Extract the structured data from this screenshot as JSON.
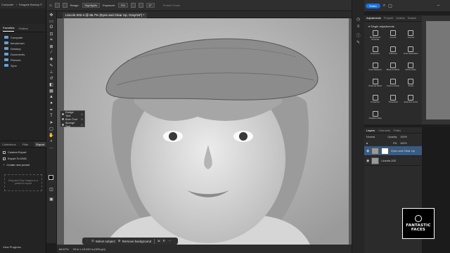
{
  "left_panel": {
    "breadcrumb": [
      "Computer",
      "Seagate Backup P"
    ],
    "tabs": [
      "Favorites",
      "Folders"
    ],
    "folders": [
      "Computer",
      "kerrybrown",
      "Desktop",
      "Documents",
      "Pictures",
      "Sync"
    ],
    "bottom_tabs": [
      "Collections",
      "Filter",
      "Export"
    ],
    "export_items": [
      "Custom Export",
      "Export To DNG",
      "Create new preset"
    ],
    "dropzone": "Drag and Drop images to a preset to export",
    "view_progress": "View Progress"
  },
  "options_bar": {
    "range_label": "Range:",
    "range_value": "Highlights",
    "exposure_label": "Exposure:",
    "exposure_value": "9%",
    "angle_value": "0°",
    "protect_tones": "Protect Tones"
  },
  "document": {
    "title": "Lincoln-202-4 @ 66.7% (Eyes and Clear Up, Gray/16*) *",
    "zoom": "66.67%",
    "doc_info": "29 in x 15.333 in (300 ppi)"
  },
  "tool_flyout": {
    "items": [
      {
        "label": "Dodge Tool",
        "key": "O"
      },
      {
        "label": "Burn Tool",
        "key": "O"
      },
      {
        "label": "Sponge Tool",
        "key": "O"
      }
    ]
  },
  "context_bar": {
    "select_subject": "Select subject",
    "remove_background": "Remove background"
  },
  "topbar_right": {
    "share": "Share"
  },
  "adjustments": {
    "tabs": [
      "Adjustments",
      "Properti",
      "Actions",
      "Swatch"
    ],
    "heading": "Single adjustments",
    "items": [
      "Brightness/ Contrast",
      "Levels",
      "Curves",
      "Exposure",
      "Vibrance",
      "Hue/ Saturation",
      "Color Balance",
      "Black & White",
      "Photo Filter",
      "Channel Mixer",
      "Color Lookup",
      "Invert",
      "Posterize",
      "Threshold",
      "Selective Color",
      "Gradient Map"
    ]
  },
  "layers": {
    "tabs": [
      "Layers",
      "Channels",
      "Paths"
    ],
    "blend_mode": "Normal",
    "opacity_label": "Opacity:",
    "opacity_value": "100%",
    "fill_label": "Fill:",
    "fill_value": "100%",
    "rows": [
      {
        "name": "Eyes and Clear Up",
        "selected": true
      },
      {
        "name": "Lincoln-202"
      }
    ]
  },
  "badge": {
    "line1": "FANTASTIC",
    "line2": "FACES"
  }
}
